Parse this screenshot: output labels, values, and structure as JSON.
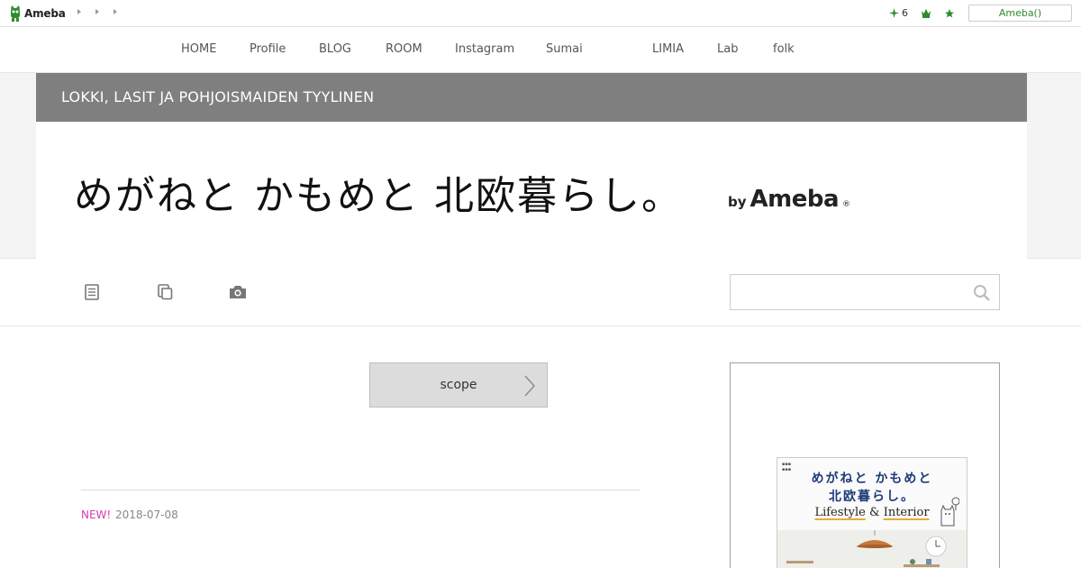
{
  "topbar": {
    "logo_text": "Ameba",
    "notification_count": "6",
    "ameba_button": "Ameba()"
  },
  "nav": {
    "items": [
      "HOME",
      "Profile",
      "BLOG",
      "ROOM",
      "Instagram",
      "Sumai",
      "LIMIA",
      "Lab",
      "folk"
    ]
  },
  "header": {
    "subtitle": "LOKKI, LASIT JA POHJOISMAIDEN TYYLINEN",
    "blog_title": "めがねと かもめと 北欧暮らし。",
    "by_text": "by",
    "brand": "Ameba",
    "reg_mark": "®"
  },
  "toolbar": {
    "icons": [
      "list-icon",
      "copy-icon",
      "camera-icon"
    ]
  },
  "search": {
    "placeholder": ""
  },
  "main": {
    "scope_label": "scope",
    "entry_new": "NEW!",
    "entry_date": "2018-07-08"
  },
  "sidebar": {
    "book_title_line1": "めがねと かもめと",
    "book_title_line2": "北欧暮らし。",
    "book_subtitle_a": "Lifestyle",
    "book_subtitle_amp": "&",
    "book_subtitle_b": "Interior"
  },
  "colors": {
    "brand_green": "#2e8b2e",
    "new_pink": "#d63eac",
    "header_gray": "#7f7f7f"
  }
}
